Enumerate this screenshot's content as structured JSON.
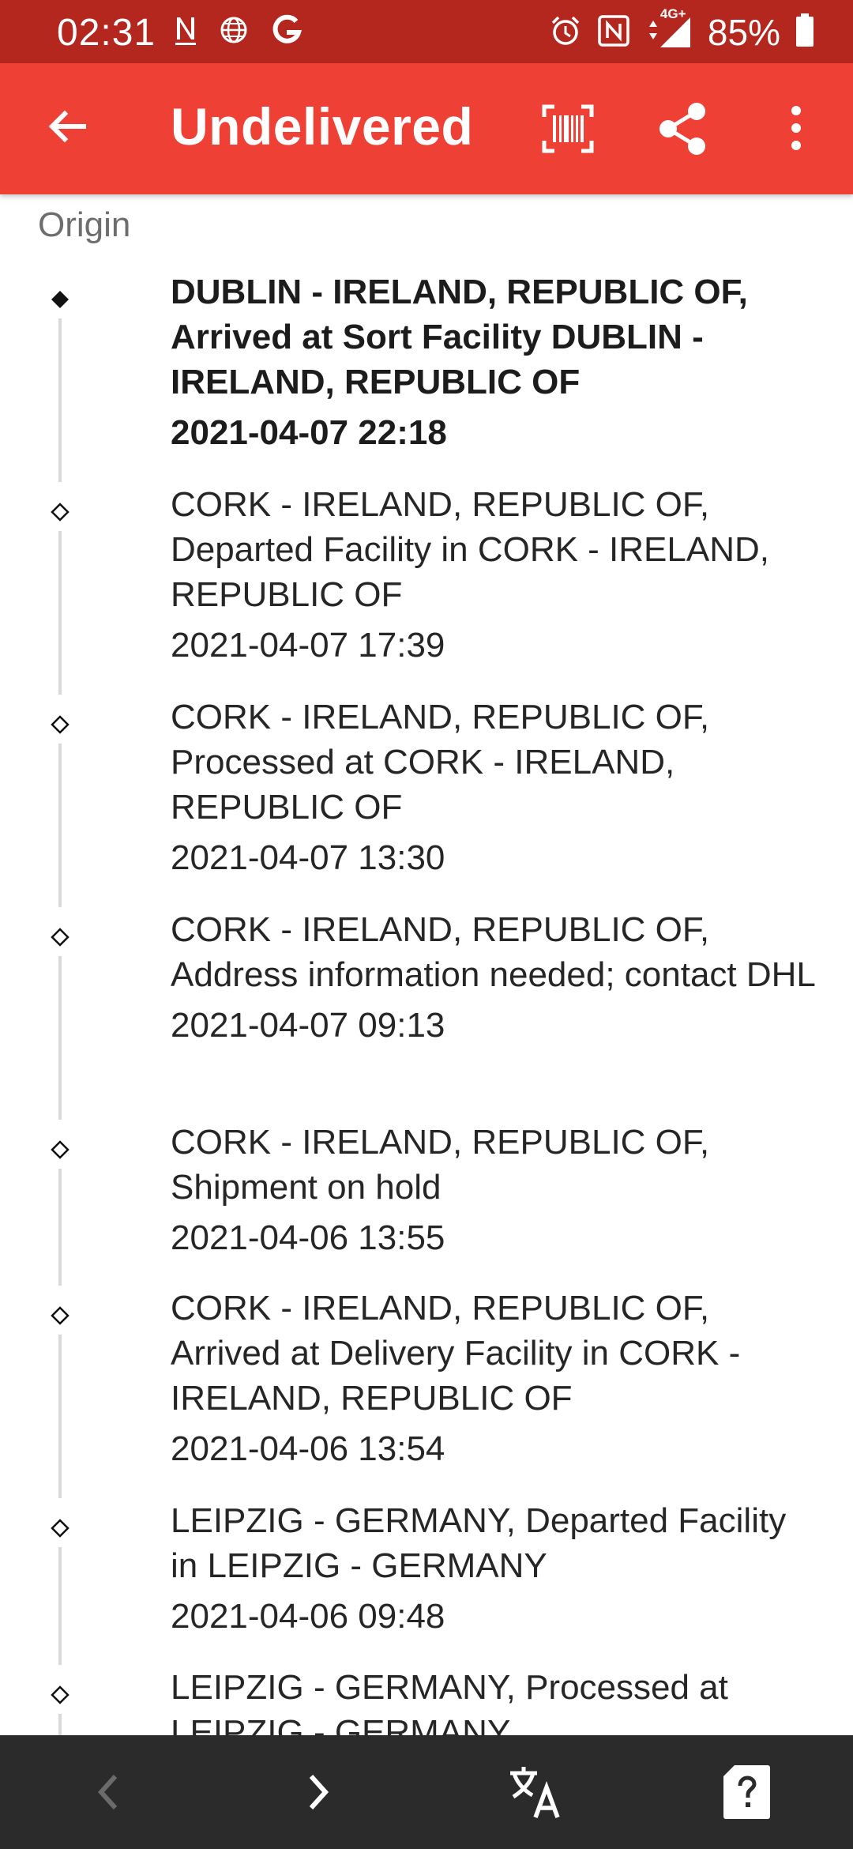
{
  "status_bar": {
    "time": "02:31",
    "battery": "85%",
    "left_icons": [
      "n-icon",
      "globe-icon",
      "g-icon"
    ],
    "right_icons": [
      "alarm-icon",
      "nfc-icon",
      "signal-4g-icon",
      "battery-icon"
    ],
    "network_label": "4G+"
  },
  "app_bar": {
    "title": "Undelivered",
    "color": "#ef4036"
  },
  "section": {
    "origin_label": "Origin"
  },
  "events": [
    {
      "description": "DUBLIN - IRELAND, REPUBLIC OF, Arrived at Sort Facility DUBLIN - IRELAND, REPUBLIC OF",
      "datetime": "2021-04-07 22:18",
      "current": true
    },
    {
      "description": "CORK - IRELAND, REPUBLIC OF, Departed Facility in CORK - IRELAND, REPUBLIC OF",
      "datetime": "2021-04-07 17:39",
      "current": false
    },
    {
      "description": "CORK - IRELAND, REPUBLIC OF, Processed at CORK - IRELAND, REPUBLIC OF",
      "datetime": "2021-04-07 13:30",
      "current": false
    },
    {
      "description": "CORK - IRELAND, REPUBLIC OF, Address information needed; contact DHL",
      "datetime": "2021-04-07 09:13",
      "current": false
    },
    {
      "description": "CORK - IRELAND, REPUBLIC OF, Shipment on hold",
      "datetime": "2021-04-06 13:55",
      "current": false
    },
    {
      "description": "CORK - IRELAND, REPUBLIC OF, Arrived at Delivery Facility in CORK - IRELAND, REPUBLIC OF",
      "datetime": "2021-04-06 13:54",
      "current": false
    },
    {
      "description": "LEIPZIG - GERMANY, Departed Facility in LEIPZIG - GERMANY",
      "datetime": "2021-04-06 09:48",
      "current": false
    },
    {
      "description": "LEIPZIG - GERMANY, Processed at LEIPZIG - GERMANY",
      "datetime": "",
      "current": false
    }
  ],
  "bottom_nav": {
    "icons": [
      "chevron-left-icon",
      "chevron-right-icon",
      "translate-icon",
      "help-card-icon"
    ]
  }
}
